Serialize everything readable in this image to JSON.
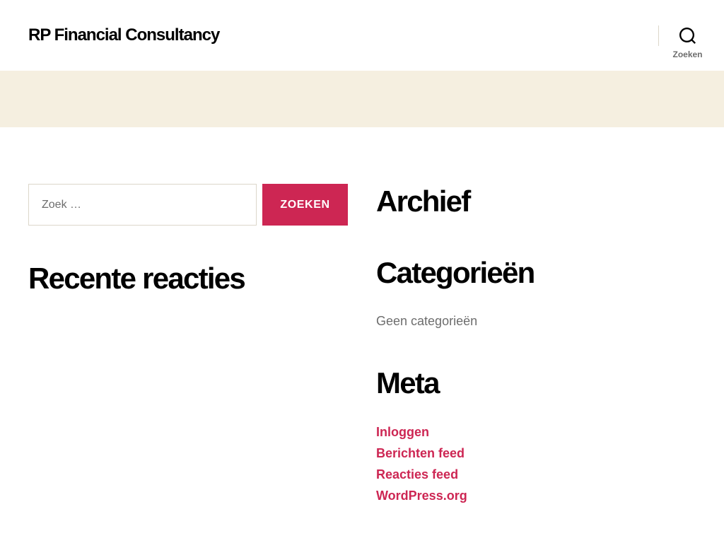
{
  "site": {
    "title": "RP Financial Consultancy"
  },
  "header": {
    "search_toggle": {
      "label": "Zoeken",
      "icon": "search-icon"
    }
  },
  "colors": {
    "accent": "#cd2653",
    "band": "#f5efe0",
    "text": "#000000",
    "muted": "#6d6d6d",
    "border": "#dcd7ca",
    "background": "#ffffff"
  },
  "widgets": {
    "search": {
      "placeholder": "Zoek …",
      "button_label": "ZOEKEN"
    },
    "recent_comments": {
      "title": "Recente reacties"
    },
    "archive": {
      "title": "Archief"
    },
    "categories": {
      "title": "Categorieën",
      "empty_message": "Geen categorieën"
    },
    "meta": {
      "title": "Meta",
      "links": [
        {
          "label": "Inloggen"
        },
        {
          "label": "Berichten feed"
        },
        {
          "label": "Reacties feed"
        },
        {
          "label": "WordPress.org"
        }
      ]
    }
  }
}
